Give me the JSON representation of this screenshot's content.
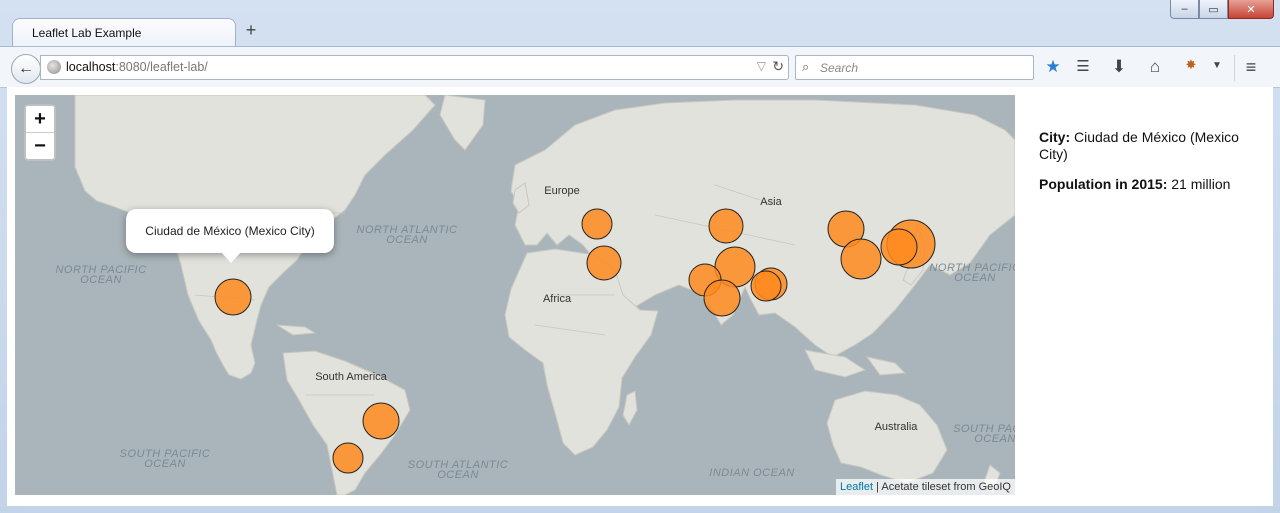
{
  "window": {
    "tab_title": "Leaflet Lab Example",
    "minimize_glyph": "‒",
    "maximize_glyph": "▭",
    "close_glyph": "✕",
    "new_tab_glyph": "+"
  },
  "navbar": {
    "url_host": "localhost",
    "url_rest": ":8080/leaflet-lab/",
    "search_placeholder": "Search",
    "icons": [
      "back-icon",
      "globe-icon",
      "dropdown-icon",
      "reload-icon",
      "search-icon",
      "bookmark-star-icon",
      "reading-list-icon",
      "download-icon",
      "home-icon",
      "addon-icon",
      "menu-icon"
    ]
  },
  "map": {
    "zoom_in": "+",
    "zoom_out": "−",
    "popup_text": "Ciudad de México (Mexico City)",
    "attribution_link": "Leaflet",
    "attribution_text": " | Acetate tileset from GeoIQ",
    "marker_fill": "#ff8a1f",
    "marker_stroke": "#222222",
    "ocean_color": "#a9b5ba",
    "land_color": "#e2e2dc",
    "labels": {
      "north_atlantic_1": "NORTH ATLANTIC",
      "north_atlantic_2": "OCEAN",
      "north_pacific_w_1": "NORTH PACIFIC",
      "north_pacific_w_2": "OCEAN",
      "north_pacific_e_1": "NORTH PACIFIC",
      "north_pacific_e_2": "OCEAN",
      "south_pacific_w_1": "SOUTH PACIFIC",
      "south_pacific_w_2": "OCEAN",
      "south_pacific_e_1": "SOUTH PAC",
      "south_pacific_e_2": "OCEAN",
      "south_atlantic_1": "SOUTH ATLANTIC",
      "south_atlantic_2": "OCEAN",
      "indian_ocean": "INDIAN OCEAN",
      "europe": "Europe",
      "asia": "Asia",
      "africa": "Africa",
      "south_america": "South America",
      "australia": "Australia"
    }
  },
  "panel": {
    "city_label": "City:",
    "city_value": " Ciudad de México (Mexico City)",
    "population_label": "Population in 2015:",
    "population_value": " 21 million"
  }
}
